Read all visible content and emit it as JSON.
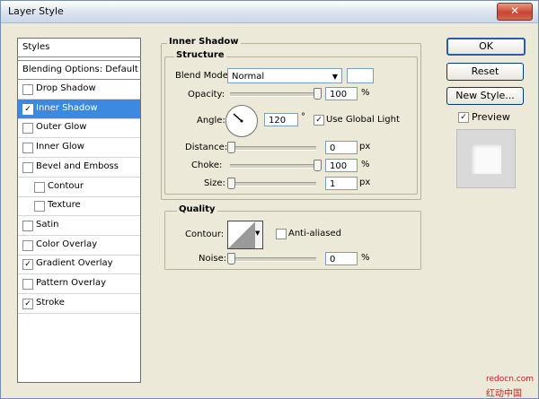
{
  "window": {
    "title": "Layer Style",
    "close_label": "✕"
  },
  "styles_panel": {
    "header": "Styles",
    "blending": "Blending Options: Default",
    "items": [
      {
        "label": "Drop Shadow",
        "checked": false
      },
      {
        "label": "Inner Shadow",
        "checked": true,
        "selected": true
      },
      {
        "label": "Outer Glow",
        "checked": false
      },
      {
        "label": "Inner Glow",
        "checked": false
      },
      {
        "label": "Bevel and Emboss",
        "checked": false
      },
      {
        "label": "Contour",
        "checked": false,
        "sub": true
      },
      {
        "label": "Texture",
        "checked": false,
        "sub": true
      },
      {
        "label": "Satin",
        "checked": false
      },
      {
        "label": "Color Overlay",
        "checked": false
      },
      {
        "label": "Gradient Overlay",
        "checked": true
      },
      {
        "label": "Pattern Overlay",
        "checked": false
      },
      {
        "label": "Stroke",
        "checked": true
      }
    ]
  },
  "inner_shadow": {
    "section_title": "Inner Shadow",
    "structure_title": "Structure",
    "blend_mode_label": "Blend Mode:",
    "blend_mode_value": "Normal",
    "blend_color": "#ffffff",
    "opacity_label": "Opacity:",
    "opacity_value": "100",
    "opacity_level": 1.0,
    "angle_label": "Angle:",
    "angle_value": "120",
    "angle_unit": "°",
    "use_global_light_label": "Use Global Light",
    "use_global_light_checked": true,
    "distance_label": "Distance:",
    "distance_value": "0",
    "distance_level": 0.0,
    "choke_label": "Choke:",
    "choke_value": "100",
    "choke_level": 1.0,
    "size_label": "Size:",
    "size_value": "1",
    "size_level": 0.0,
    "unit_px": "px",
    "unit_percent": "%"
  },
  "quality": {
    "title": "Quality",
    "contour_label": "Contour:",
    "anti_aliased_label": "Anti-aliased",
    "anti_aliased_checked": false,
    "noise_label": "Noise:",
    "noise_value": "0",
    "noise_level": 0.0,
    "unit_percent": "%"
  },
  "buttons": {
    "ok": "OK",
    "reset": "Reset",
    "new_style": "New Style..."
  },
  "preview": {
    "label": "Preview",
    "checked": true
  },
  "watermark": {
    "line1": "redocn.com",
    "line2": "红动中国"
  },
  "colors": {
    "selection": "#3b89e0",
    "dialog_bg": "#ece9d8",
    "close_button": "#c9462f"
  }
}
